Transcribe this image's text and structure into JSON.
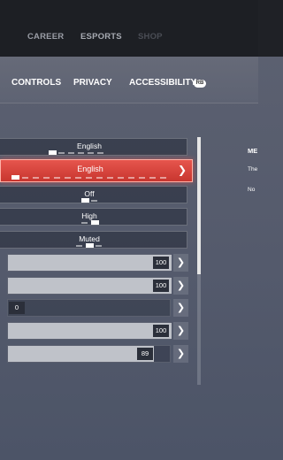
{
  "top_nav": {
    "items": [
      {
        "label": "CAREER",
        "color": "#9a9da6"
      },
      {
        "label": "ESPORTS",
        "color": "#a7aab2"
      },
      {
        "label": "SHOP",
        "color": "#4a4d55"
      }
    ]
  },
  "sub_nav": {
    "tabs": [
      "CONTROLS",
      "PRIVACY",
      "ACCESSIBILITY"
    ],
    "badge": "RB"
  },
  "option_rows": [
    {
      "label": "English",
      "selected": false
    },
    {
      "label": "English",
      "selected": true
    },
    {
      "label": "Off",
      "selected": false
    },
    {
      "label": "High",
      "selected": false
    },
    {
      "label": "Muted",
      "selected": false
    }
  ],
  "sliders": [
    {
      "value": "100",
      "level": 100
    },
    {
      "value": "100",
      "level": 100
    },
    {
      "value": "0",
      "level": 0
    },
    {
      "value": "100",
      "level": 100
    },
    {
      "value": "89",
      "level": 89
    }
  ],
  "side_panel": {
    "title": "ME",
    "line1": "The",
    "line2": "No"
  },
  "colors": {
    "accent": "#d8443c",
    "slider_fill": "#bfc2c9"
  }
}
